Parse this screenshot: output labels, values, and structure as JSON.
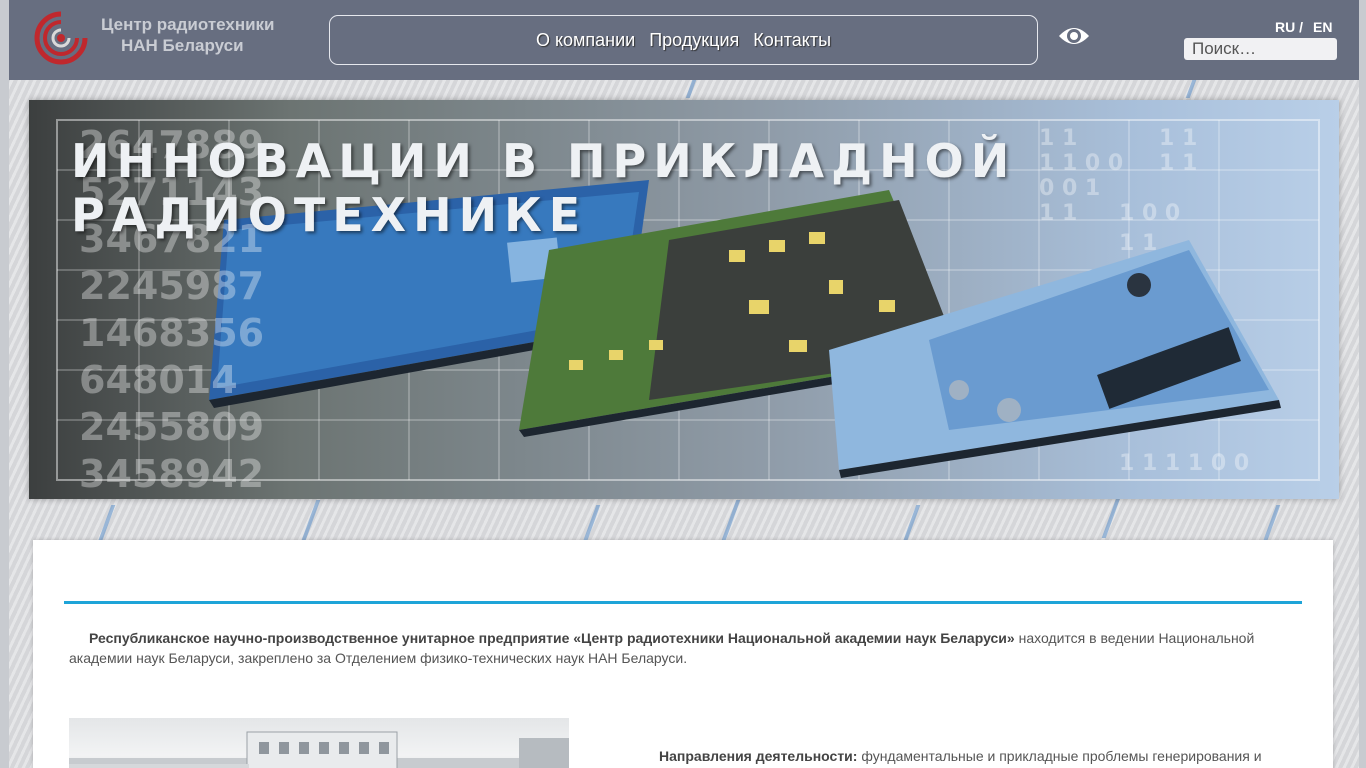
{
  "header": {
    "logo_line1": "Центр радиотехники",
    "logo_line2": "НАН Беларуси",
    "nav": [
      "О компании",
      "Продукция",
      "Контакты"
    ],
    "lang_ru": "RU /",
    "lang_en": "EN",
    "search_placeholder": "Поиск…",
    "accessibility_icon": "eye-icon"
  },
  "banner": {
    "title_line1": "ИННОВАЦИИ В ПРИКЛАДНОЙ",
    "title_line2": "РАДИОТЕХНИКЕ",
    "numbers": [
      "2647889",
      "5271143",
      "3467821",
      "2245987",
      "1468356",
      "648014",
      "2455809",
      "3458942"
    ]
  },
  "content": {
    "intro_bold": "Республиканское научно-производственное унитарное предприятие «Центр радиотехники Национальной академии наук Беларуси»",
    "intro_rest": " находится в ведении Национальной академии наук Беларуси, закреплено за Отделением физико-технических наук НАН Беларуси.",
    "directions_bold": "Направления деятельности:",
    "directions_rest": " фундаментальные и прикладные проблемы генерирования и"
  },
  "colors": {
    "header_bg": "#676e80",
    "accent_rule": "#1ea4d8",
    "logo_red": "#c0282d"
  }
}
